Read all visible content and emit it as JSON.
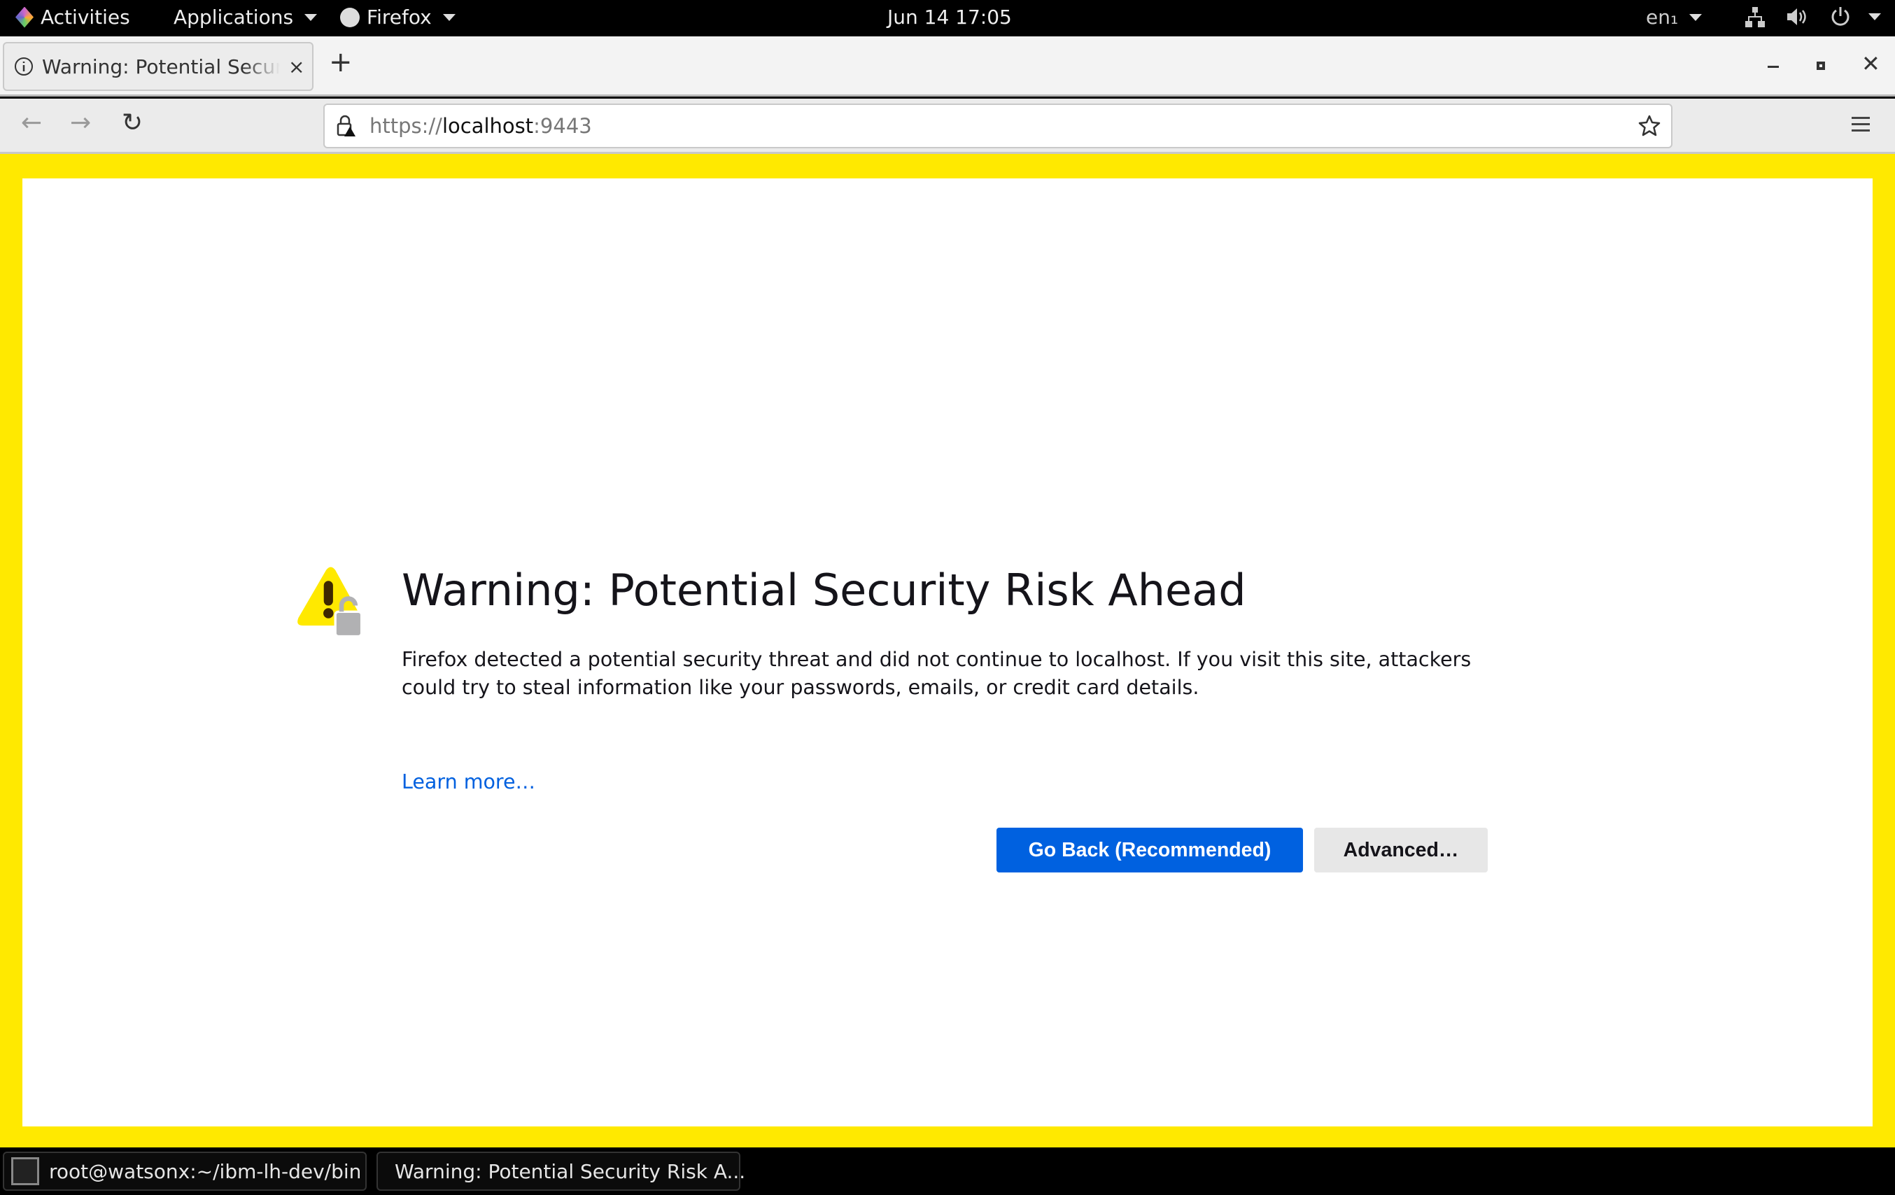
{
  "topbar": {
    "activities": "Activities",
    "applications": "Applications",
    "app_menu": "Firefox",
    "clock": "Jun 14  17:05",
    "keyboard": "en₁",
    "icons": [
      "network-icon",
      "volume-icon",
      "power-icon"
    ]
  },
  "browser": {
    "tab_title": "Warning: Potential Security Risk Ahead",
    "tab_title_visible": "Warning: Potential Securit",
    "url_scheme": "https://",
    "url_host": "localhost",
    "url_port": ":9443"
  },
  "page": {
    "title": "Warning: Potential Security Risk Ahead",
    "description": "Firefox detected a potential security threat and did not continue to localhost. If you visit this site, attackers could try to steal information like your passwords, emails, or credit card details.",
    "learn_more": "Learn more…",
    "go_back": "Go Back (Recommended)",
    "advanced": "Advanced…"
  },
  "taskbar": {
    "items": [
      {
        "label": "root@watsonx:~/ibm-lh-dev/bin",
        "icon": "terminal-icon"
      },
      {
        "label": "Warning: Potential Security Risk A...",
        "icon": "firefox-icon"
      }
    ]
  },
  "colors": {
    "frame": "#ffe900",
    "primary_button": "#0061e0",
    "link": "#0060df"
  }
}
